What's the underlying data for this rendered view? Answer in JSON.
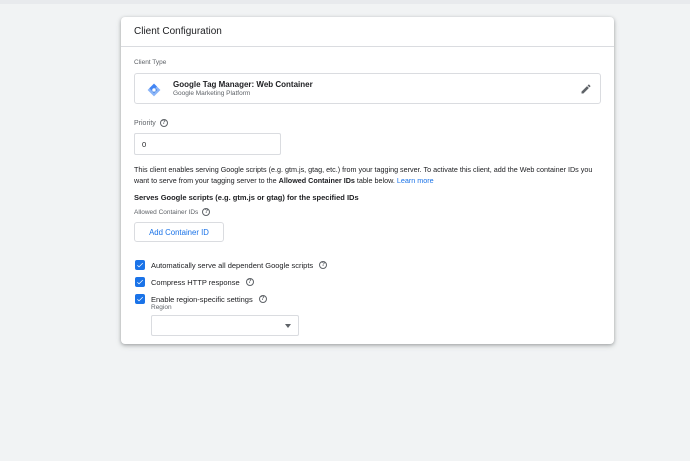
{
  "card": {
    "title": "Client Configuration"
  },
  "client_type": {
    "label": "Client Type",
    "name": "Google Tag Manager: Web Container",
    "subtitle": "Google Marketing Platform"
  },
  "priority": {
    "label": "Priority",
    "value": "0"
  },
  "description": {
    "text_1": "This client enables serving Google scripts (e.g. gtm.js, gtag, etc.) from your tagging server. To activate this client, add the Web container IDs you want to serve from your tagging server to the ",
    "bold": "Allowed Container IDs",
    "text_2": " table below. ",
    "link": "Learn more"
  },
  "serves": {
    "title": "Serves Google scripts (e.g. gtm.js or gtag) for the specified IDs",
    "allowed_label": "Allowed Container IDs",
    "add_button": "Add Container ID"
  },
  "options": [
    {
      "label": "Automatically serve all dependent Google scripts",
      "checked": true
    },
    {
      "label": "Compress HTTP response",
      "checked": true
    },
    {
      "label": "Enable region-specific settings",
      "checked": true
    }
  ],
  "region": {
    "label": "Region",
    "value": ""
  },
  "colors": {
    "accent": "#1a73e8",
    "background": "#f1f3f4"
  }
}
